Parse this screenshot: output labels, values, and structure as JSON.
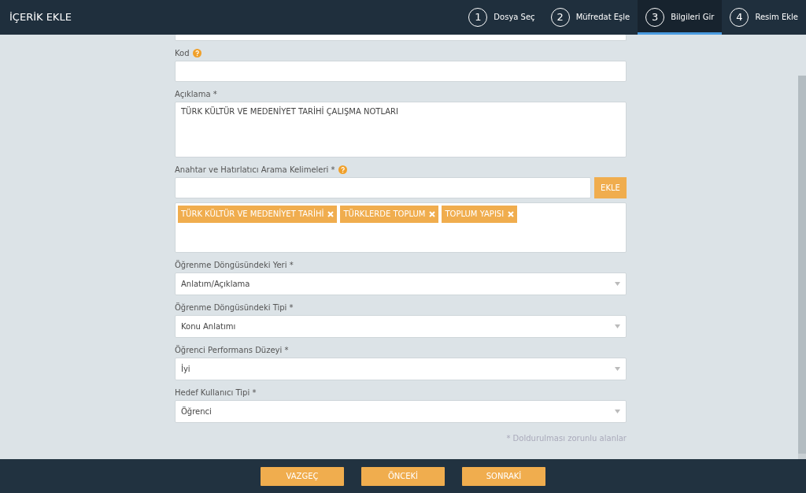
{
  "header": {
    "title": "İÇERİK EKLE"
  },
  "steps": [
    {
      "number": "1",
      "label": "Dosya Seç",
      "selected": false
    },
    {
      "number": "2",
      "label": "Müfredat Eşle",
      "selected": false
    },
    {
      "number": "3",
      "label": "Bilgileri Gir",
      "selected": true
    },
    {
      "number": "4",
      "label": "Resim Ekle",
      "selected": false
    }
  ],
  "fields": [
    {
      "kind": "input",
      "label": "Kod",
      "help": true
    },
    {
      "kind": "textarea",
      "label": "Açıklama *",
      "help": false,
      "value": "TÜRK KÜLTÜR VE MEDENİYET TARİHİ ÇALIŞMA NOTLARI"
    },
    {
      "kind": "tags",
      "label": "Anahtar ve Hatırlatıcı Arama Kelimeleri *",
      "help": true,
      "button": "EKLE",
      "tags": [
        "TÜRK KÜLTÜR VE MEDENİYET TARİHİ",
        "TÜRKLERDE TOPLUM",
        "TOPLUM YAPISI"
      ]
    },
    {
      "kind": "select",
      "label": "Öğrenme Döngüsündeki Yeri *",
      "help": false,
      "value": "Anlatım/Açıklama"
    },
    {
      "kind": "select",
      "label": "Öğrenme Döngüsündeki Tipi *",
      "help": false,
      "value": "Konu Anlatımı"
    },
    {
      "kind": "select",
      "label": "Öğrenci Performans Düzeyi *",
      "help": false,
      "value": "İyi"
    },
    {
      "kind": "select",
      "label": "Hedef Kullanıcı Tipi *",
      "help": false,
      "value": "Öğrenci"
    }
  ],
  "note": "* Doldurulması zorunlu alanlar",
  "buttons": [
    "VAZGEÇ",
    "ÖNCEKİ",
    "SONRAKİ"
  ]
}
